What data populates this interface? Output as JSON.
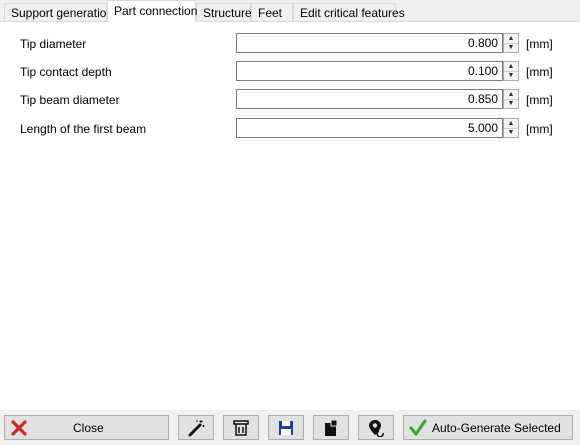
{
  "tabs": [
    {
      "label": "Support generation",
      "active": false
    },
    {
      "label": "Part connection",
      "active": true
    },
    {
      "label": "Structure",
      "active": false
    },
    {
      "label": "Feet",
      "active": false
    },
    {
      "label": "Edit critical features",
      "active": false
    }
  ],
  "fields": [
    {
      "label": "Tip diameter",
      "value": "0.800",
      "unit": "[mm]"
    },
    {
      "label": "Tip contact depth",
      "value": "0.100",
      "unit": "[mm]"
    },
    {
      "label": "Tip beam diameter",
      "value": "0.850",
      "unit": "[mm]"
    },
    {
      "label": "Length of the first beam",
      "value": "5.000",
      "unit": "[mm]"
    }
  ],
  "toolbar": {
    "close_label": "Close",
    "auto_generate_label": "Auto-Generate Selected",
    "icons": [
      "close-x-icon",
      "magic-wand-icon",
      "trash-icon",
      "save-icon",
      "clipboard-icon",
      "location-refresh-icon",
      "checkmark-icon"
    ]
  },
  "colors": {
    "close_x": "#cc2a1a",
    "save_blue": "#1e3fa8",
    "check_green": "#3aa52c"
  }
}
